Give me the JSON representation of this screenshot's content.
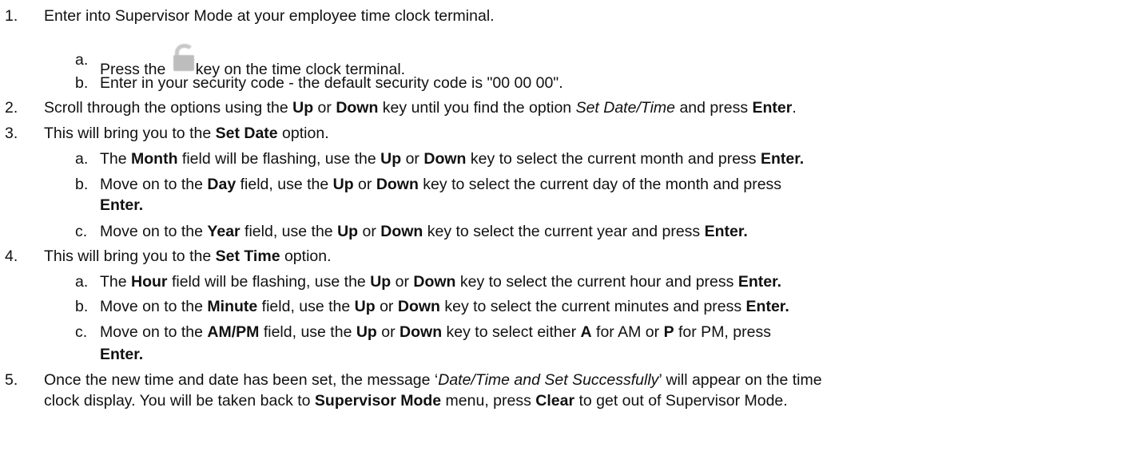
{
  "steps": [
    {
      "num": "1.",
      "text": "Enter into Supervisor Mode at your employee time clock terminal.",
      "sub": [
        {
          "num": "a.",
          "before": "Press the",
          "icon": "lock-icon",
          "after": "key on the time clock terminal."
        },
        {
          "num": "b.",
          "text": "Enter in your security code - the default security code is \"00 00 00\"."
        }
      ]
    },
    {
      "num": "2.",
      "t1": "Scroll through the options using the ",
      "b1": "Up",
      "t2": " or ",
      "b2": "Down",
      "t3": " key until you find the option ",
      "i1": "Set Date/Time",
      "t4": " and press ",
      "b3": "Enter",
      "t5": "."
    },
    {
      "num": "3.",
      "t1": "This will bring you to the ",
      "b1": "Set Date",
      "t2": " option.",
      "sub": [
        {
          "num": "a.",
          "t1": "The ",
          "b1": "Month",
          "t2": " field will be flashing, use the ",
          "b2": "Up",
          "t3": " or ",
          "b3": "Down",
          "t4": " key to select the current month and press ",
          "b4": "Enter."
        },
        {
          "num": "b.",
          "t1": "Move on to the ",
          "b1": "Day",
          "t2": " field, use the ",
          "b2": "Up",
          "t3": " or ",
          "b3": "Down",
          "t4": " key to select the current day of the month and press",
          "b4": "Enter."
        },
        {
          "num": "c.",
          "t1": "Move on to the ",
          "b1": "Year",
          "t2": " field, use the ",
          "b2": "Up",
          "t3": " or ",
          "b3": "Down",
          "t4": " key to select the current year and press ",
          "b4": "Enter."
        }
      ]
    },
    {
      "num": "4.",
      "t1": "This will bring you to the ",
      "b1": "Set Time",
      "t2": " option.",
      "sub": [
        {
          "num": "a.",
          "t1": "The ",
          "b1": "Hour",
          "t2": " field will be flashing, use the ",
          "b2": "Up",
          "t3": " or ",
          "b3": "Down",
          "t4": " key to select the current hour and press ",
          "b4": "Enter."
        },
        {
          "num": "b.",
          "t1": "Move on to the ",
          "b1": "Minute",
          "t2": " field, use the ",
          "b2": "Up",
          "t3": " or ",
          "b3": "Down",
          "t4": " key to select the current minutes and press ",
          "b4": "Enter."
        },
        {
          "num": "c.",
          "t1": "Move on to the ",
          "b1": "AM/PM",
          "t2": " field, use the ",
          "b2": "Up",
          "t3": " or ",
          "b3": "Down",
          "t4": " key to select either ",
          "b5": "A",
          "t5": " for AM or ",
          "b6": "P",
          "t6": " for PM, press",
          "b4": "Enter."
        }
      ]
    },
    {
      "num": "5.",
      "t1": "Once the new time and date has been set, the message ‘",
      "i1": "Date/Time and Set Successfully",
      "t2": "’ will appear on the time",
      "t3": "clock display.  You will be taken back to ",
      "b1": "Supervisor Mode",
      "t4": " menu, press ",
      "b2": "Clear",
      "t5": " to get out of Supervisor Mode."
    }
  ]
}
